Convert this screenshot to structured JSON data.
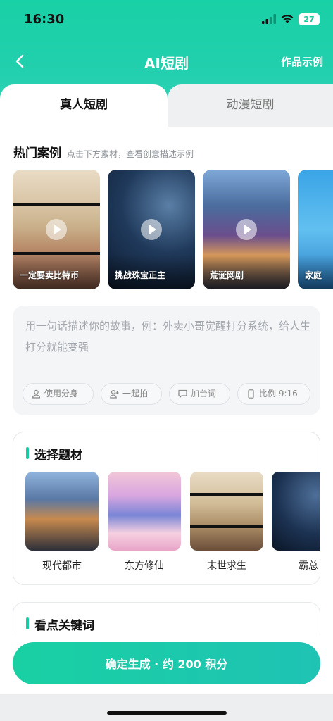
{
  "status_bar": {
    "time": "16:30",
    "battery": "27"
  },
  "nav": {
    "title": "AI短剧",
    "works_link": "作品示例"
  },
  "tabs": [
    {
      "label": "真人短剧",
      "active": true
    },
    {
      "label": "动漫短剧",
      "active": false
    }
  ],
  "hot_cases": {
    "title": "热门案例",
    "subtitle": "点击下方素材，查看创意描述示例",
    "items": [
      {
        "label": "一定要卖比特币"
      },
      {
        "label": "挑战珠宝正主"
      },
      {
        "label": "荒诞网剧"
      },
      {
        "label": "家庭"
      }
    ]
  },
  "prompt": {
    "placeholder": "用一句话描述你的故事，例：外卖小哥觉醒打分系统，给人生打分就能变强",
    "chips": [
      {
        "label": "使用分身",
        "icon": "person-icon"
      },
      {
        "label": "一起拍",
        "icon": "add-person-icon"
      },
      {
        "label": "加台词",
        "icon": "chat-bubble-icon"
      },
      {
        "label": "比例 9:16",
        "icon": "phone-ratio-icon"
      }
    ]
  },
  "topics": {
    "title": "选择题材",
    "items": [
      {
        "label": "现代都市"
      },
      {
        "label": "东方修仙"
      },
      {
        "label": "末世求生"
      },
      {
        "label": "霸总"
      }
    ]
  },
  "keywords": {
    "title": "看点关键词"
  },
  "generate_button": {
    "label": "确定生成 · 约 200 积分"
  },
  "colors": {
    "accent": "#1bc9a3",
    "hero_bg": "#22cfae"
  }
}
